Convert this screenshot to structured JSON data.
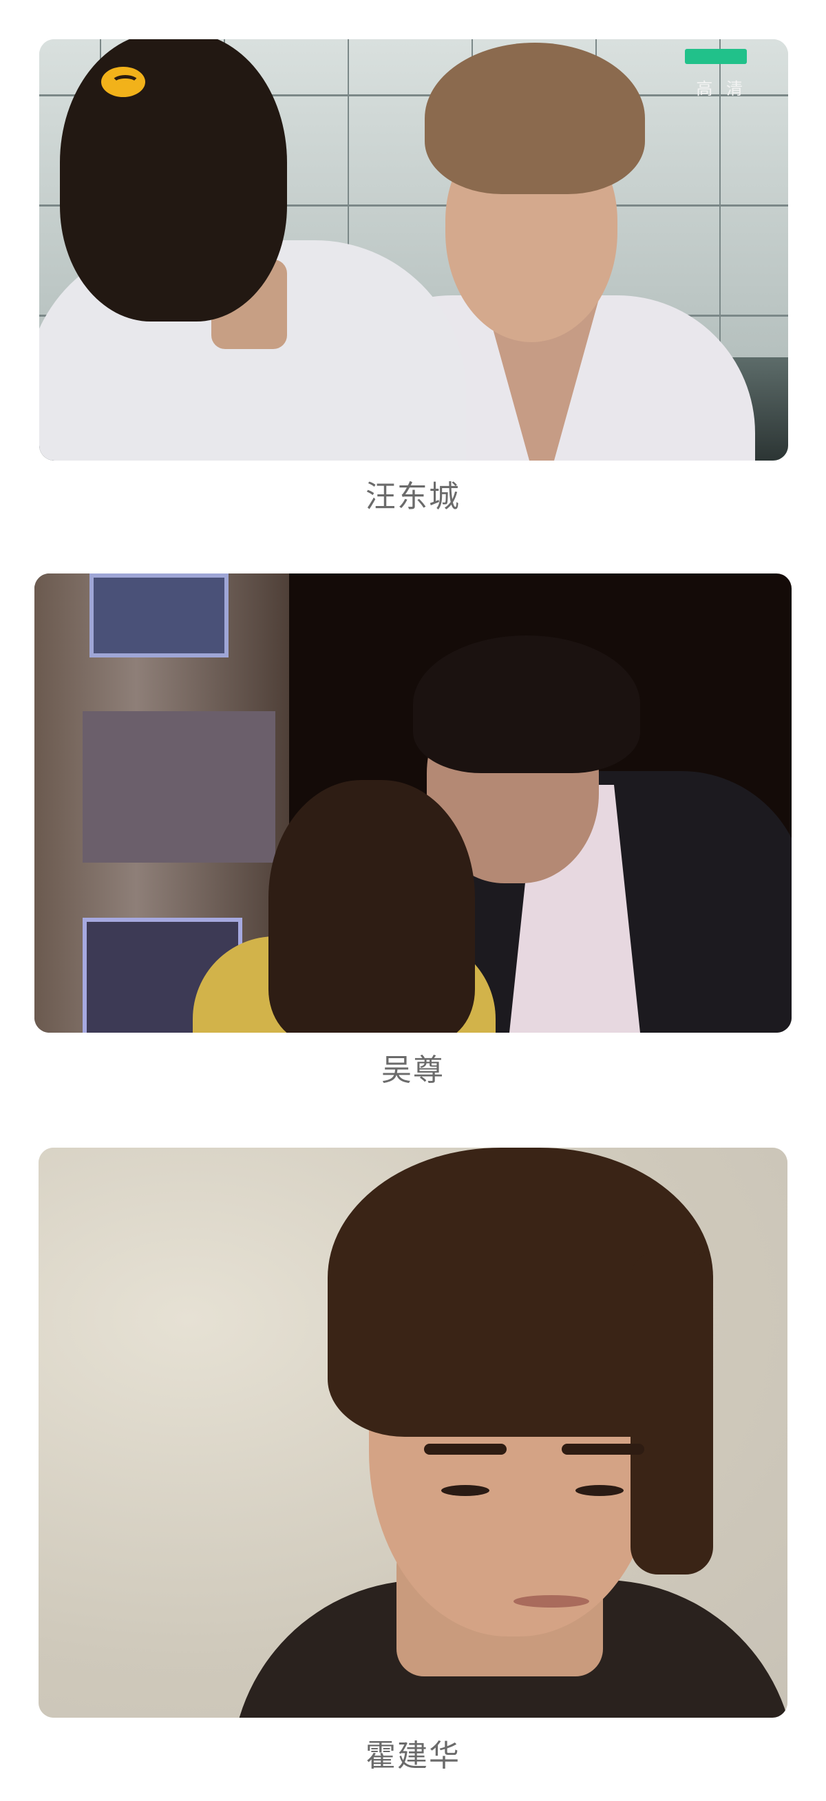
{
  "posts": [
    {
      "caption": "汪东城",
      "overlay": {
        "quality_label": "高 清",
        "logo_icon": "station-logo-icon"
      }
    },
    {
      "caption": "吴尊"
    },
    {
      "caption": "霍建华"
    }
  ],
  "colors": {
    "caption_text": "#6b6b6b",
    "background": "#ffffff",
    "logo": "#f2b21a"
  }
}
